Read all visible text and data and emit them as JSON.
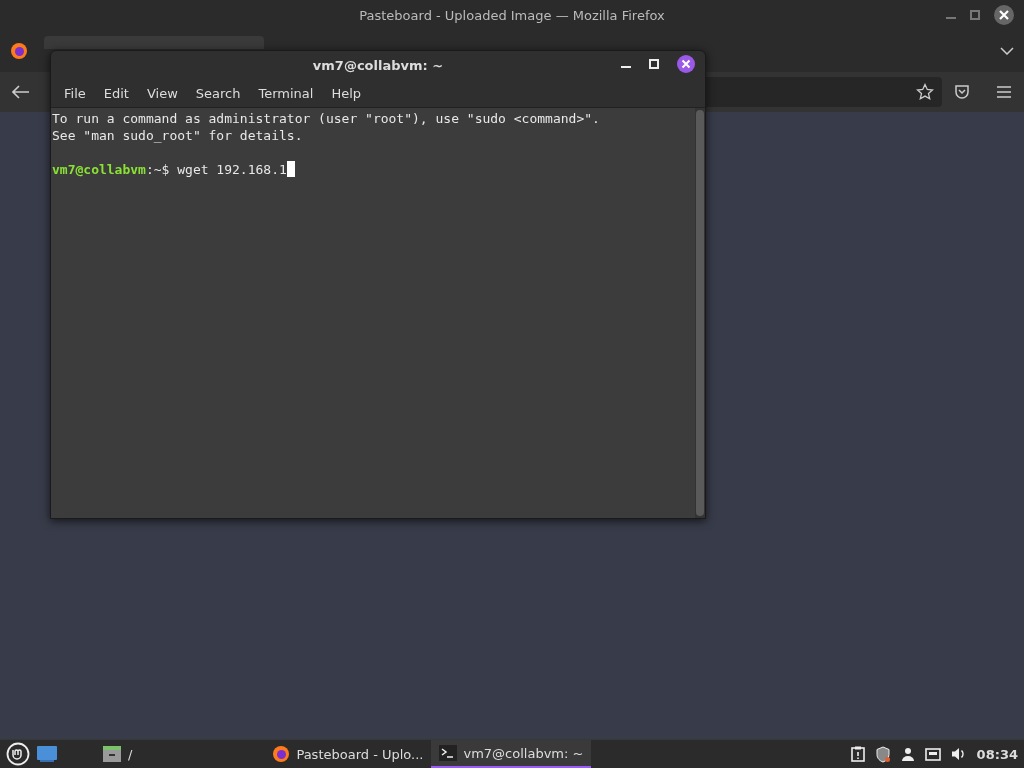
{
  "firefox": {
    "title": "Pasteboard - Uploaded Image — Mozilla Firefox"
  },
  "terminal": {
    "title": "vm7@collabvm: ~",
    "menu": [
      "File",
      "Edit",
      "View",
      "Search",
      "Terminal",
      "Help"
    ],
    "lines": [
      "To run a command as administrator (user \"root\"), use \"sudo <command>\".",
      "See \"man sudo_root\" for details."
    ],
    "prompt": {
      "user_host": "vm7@collabvm",
      "path": ":~$",
      "command": "wget 192.168.1"
    }
  },
  "taskbar": {
    "items": [
      {
        "kind": "files",
        "label": "/",
        "selected": false
      },
      {
        "kind": "firefox",
        "label": "Pasteboard - Uplo...",
        "selected": false
      },
      {
        "kind": "terminal",
        "label": "vm7@collabvm: ~",
        "selected": true
      }
    ],
    "clock": "08:34"
  }
}
